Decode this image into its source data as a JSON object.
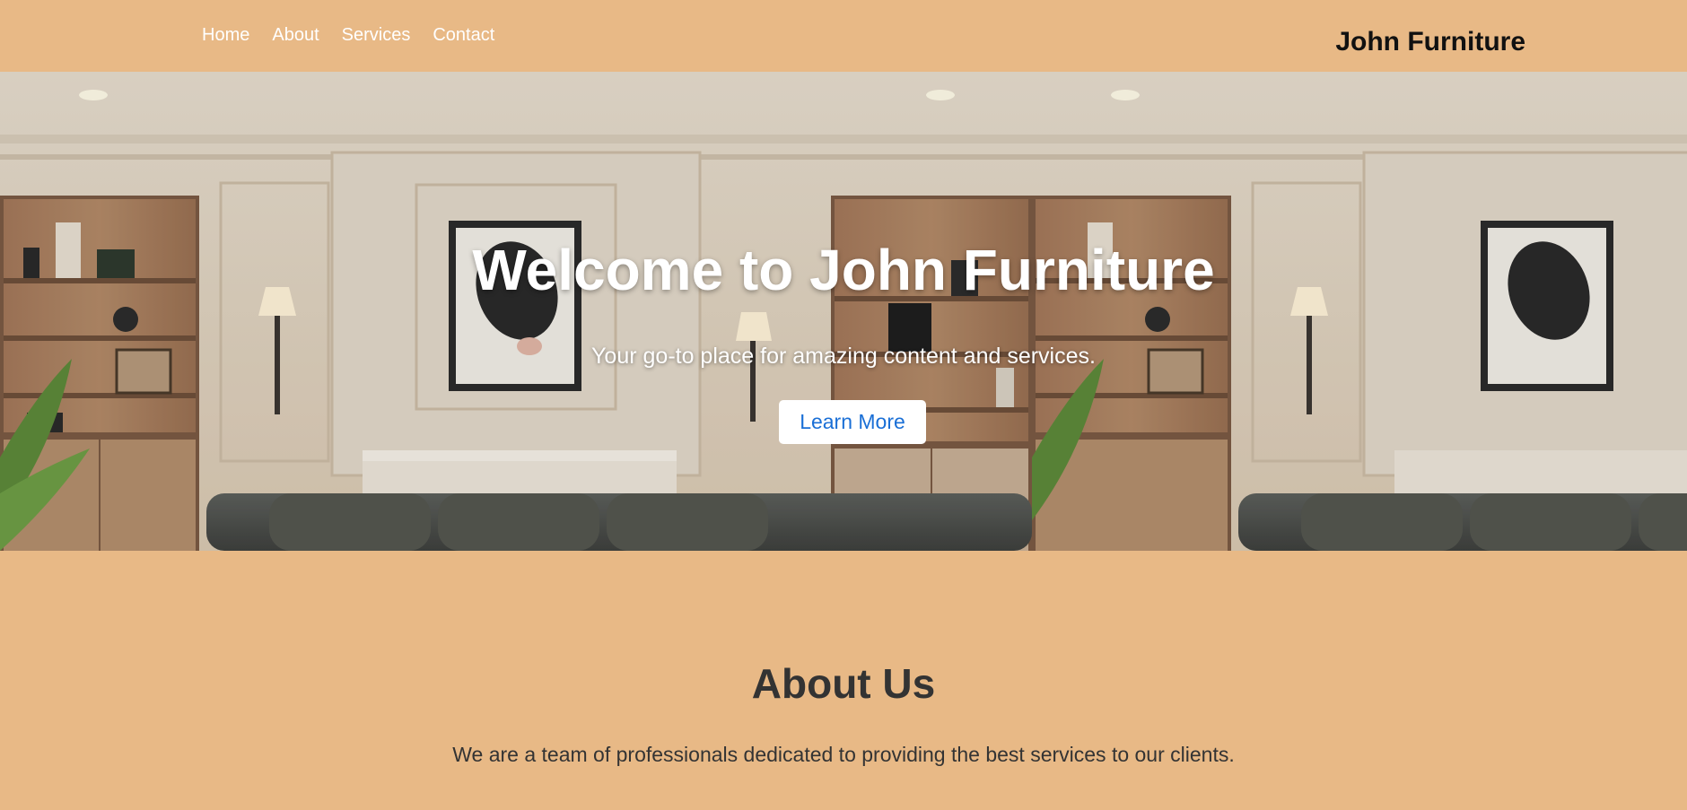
{
  "nav": {
    "items": [
      {
        "label": "Home"
      },
      {
        "label": "About"
      },
      {
        "label": "Services"
      },
      {
        "label": "Contact"
      }
    ]
  },
  "brand": "John Furniture",
  "hero": {
    "title": "Welcome to John Furniture",
    "subtitle": "Your go-to place for amazing content and services.",
    "button_label": "Learn More"
  },
  "about": {
    "title": "About Us",
    "text": "We are a team of professionals dedicated to providing the best services to our clients."
  },
  "colors": {
    "background": "#e8b986",
    "nav_text": "#ffffff",
    "heading_text": "#333333",
    "button_text": "#1a6fd6"
  }
}
